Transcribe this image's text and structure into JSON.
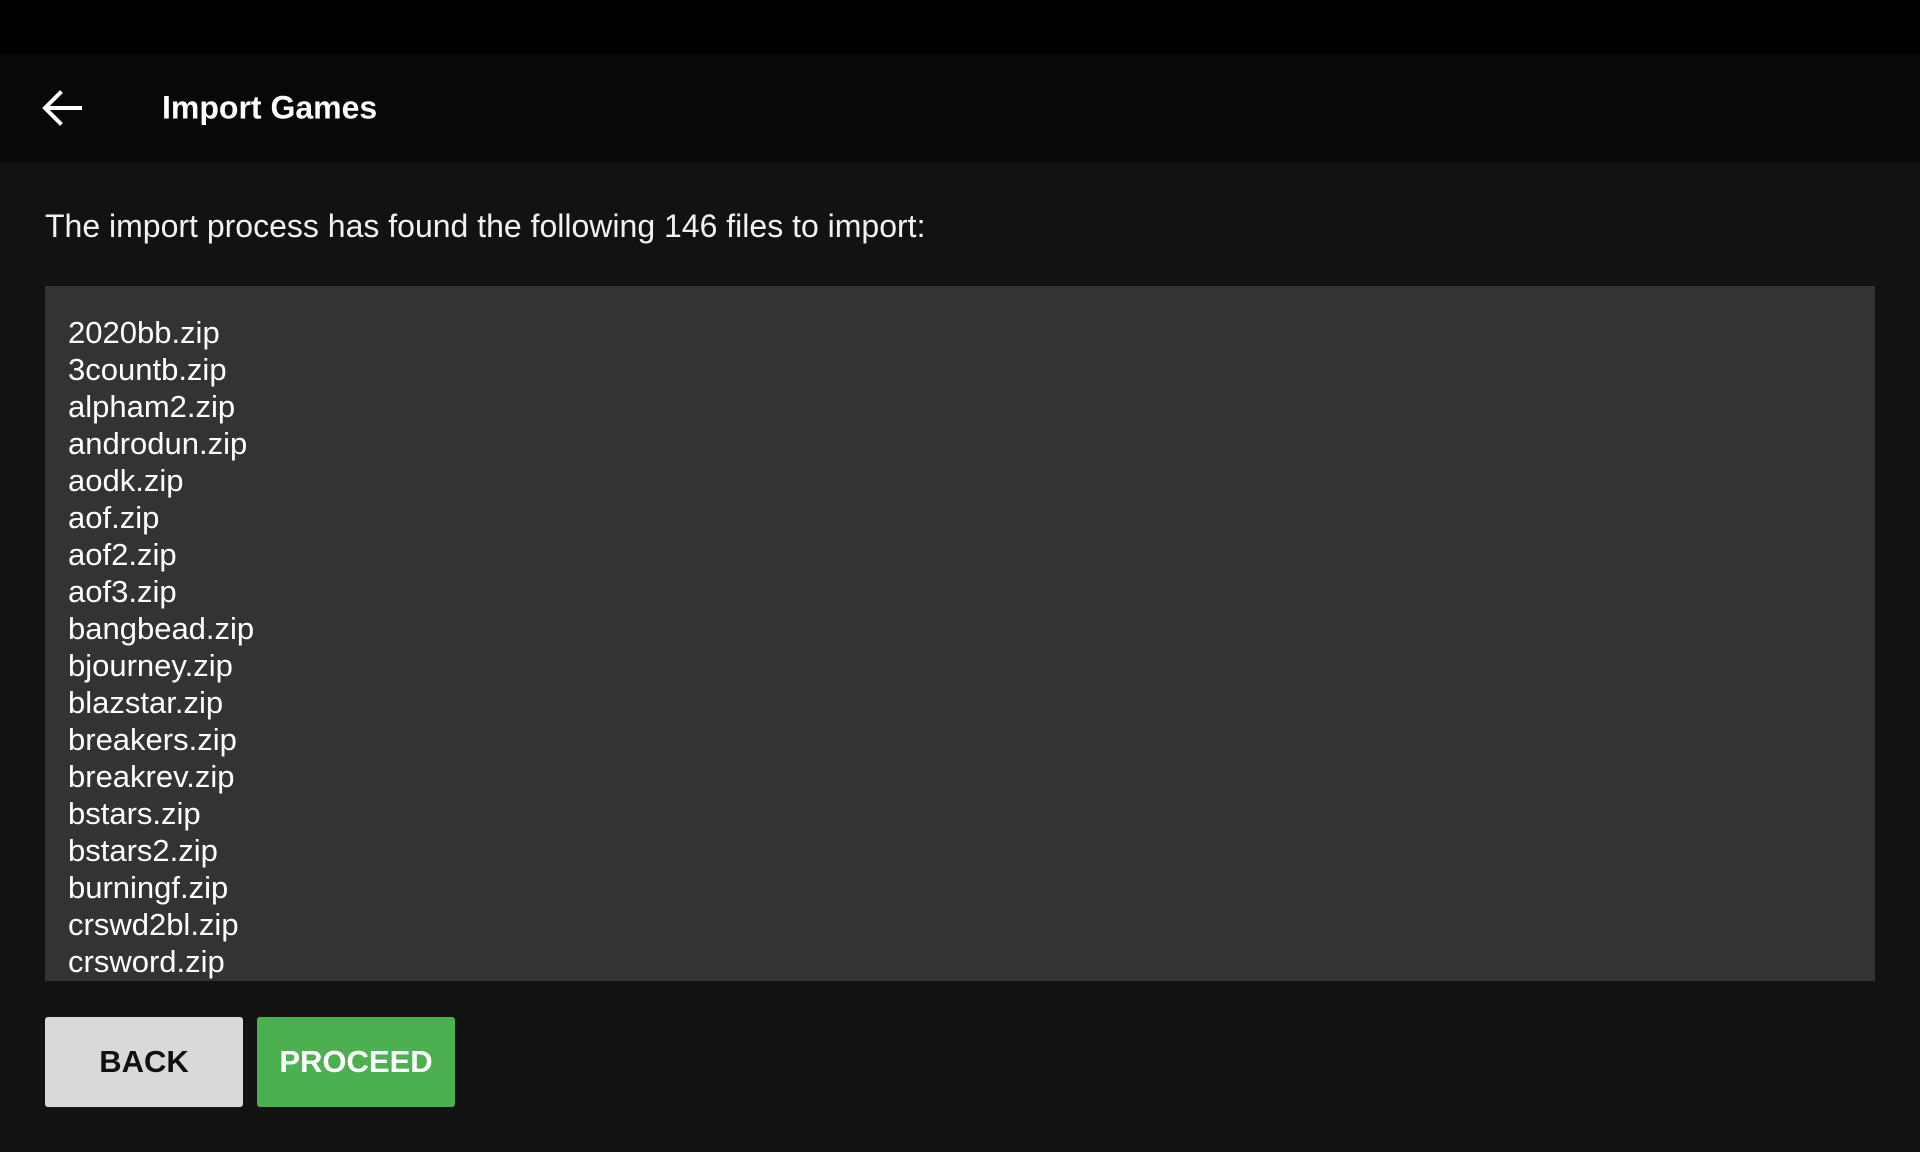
{
  "app_bar": {
    "title": "Import Games",
    "back_icon": "arrow-left-icon"
  },
  "main": {
    "description": "The import process has found the following 146 files to import:",
    "files": [
      "2020bb.zip",
      "3countb.zip",
      "alpham2.zip",
      "androdun.zip",
      "aodk.zip",
      "aof.zip",
      "aof2.zip",
      "aof3.zip",
      "bangbead.zip",
      "bjourney.zip",
      "blazstar.zip",
      "breakers.zip",
      "breakrev.zip",
      "bstars.zip",
      "bstars2.zip",
      "burningf.zip",
      "crswd2bl.zip",
      "crsword.zip"
    ]
  },
  "actions": {
    "back_label": "BACK",
    "proceed_label": "PROCEED"
  },
  "colors": {
    "proceed_button": "#4caf50",
    "back_button": "#d9d9d9",
    "list_background": "#333333",
    "page_background": "#121212"
  }
}
